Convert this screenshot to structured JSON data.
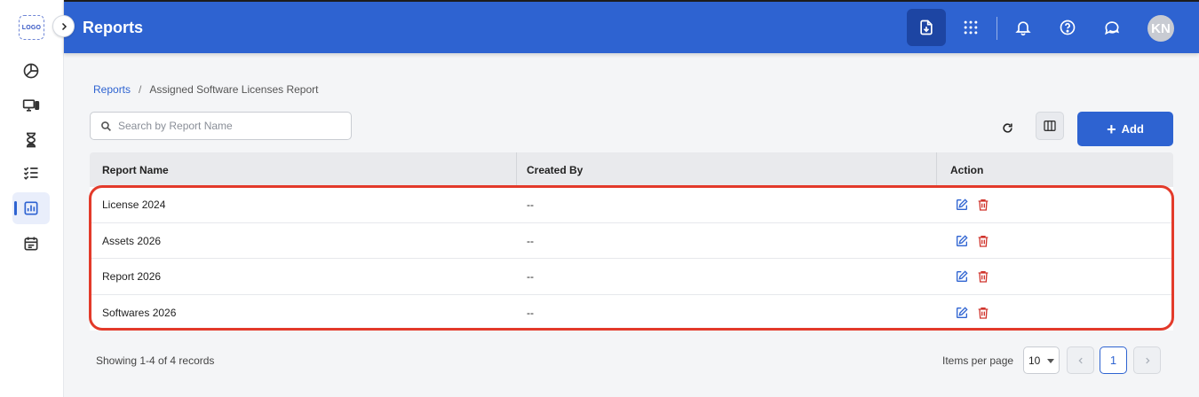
{
  "app": {
    "logo_text": "LOGO",
    "title": "Reports",
    "avatar_initials": "KN"
  },
  "sidebar": {
    "items": [
      {
        "icon": "pie-chart-icon",
        "active": false
      },
      {
        "icon": "devices-icon",
        "active": false
      },
      {
        "icon": "hourglass-icon",
        "active": false
      },
      {
        "icon": "checklist-icon",
        "active": false
      },
      {
        "icon": "report-chart-icon",
        "active": true
      },
      {
        "icon": "calendar-icon",
        "active": false
      }
    ]
  },
  "topbar": {
    "icons": [
      "download-report-icon",
      "apps-grid-icon",
      "bell-icon",
      "help-icon",
      "chat-icon"
    ]
  },
  "breadcrumb": {
    "root": "Reports",
    "separator": "/",
    "current": "Assigned Software Licenses Report"
  },
  "search": {
    "placeholder": "Search by Report Name",
    "value": ""
  },
  "toolbar": {
    "add_label": "Add"
  },
  "table": {
    "columns": [
      "Report Name",
      "Created By",
      "Action"
    ],
    "rows": [
      {
        "name": "License 2024",
        "created_by": "--"
      },
      {
        "name": "Assets 2026",
        "created_by": "--"
      },
      {
        "name": "Report 2026",
        "created_by": "--"
      },
      {
        "name": "Softwares 2026",
        "created_by": "--"
      }
    ]
  },
  "footer": {
    "records_text": "Showing 1-4 of 4 records",
    "items_per_page_label": "Items per page",
    "items_per_page_value": "10",
    "current_page": "1"
  },
  "colors": {
    "primary": "#2e63d1",
    "highlight": "#e33a2a",
    "delete": "#d0342c"
  }
}
